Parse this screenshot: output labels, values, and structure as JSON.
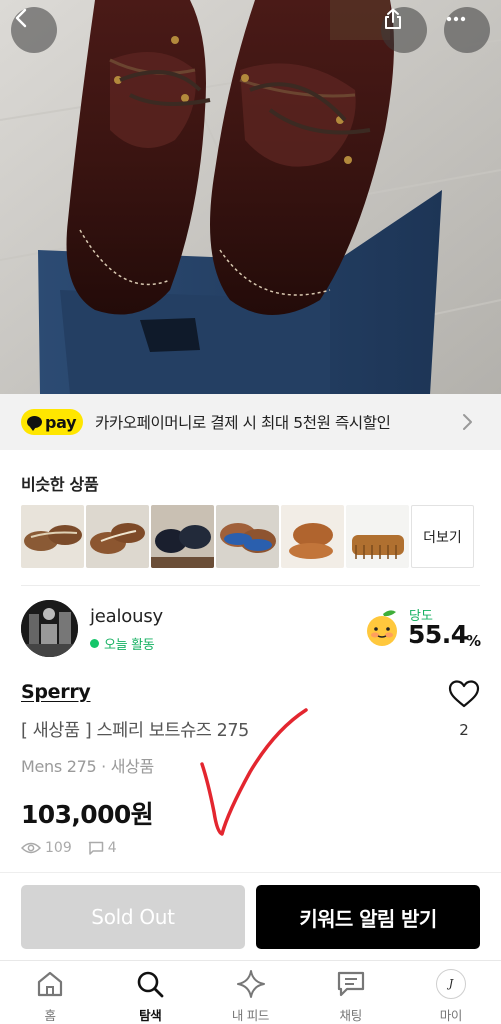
{
  "colors": {
    "pay_yellow": "#ffe600",
    "online_green": "#16b162",
    "sold_out_gray": "#d4d4d4",
    "primary_black": "#000000",
    "annotation_red": "#e3262f"
  },
  "header": {
    "back_icon": "chevron-left-icon",
    "share_icon": "share-icon",
    "more_icon": "more-horizontal-icon"
  },
  "pay_banner": {
    "badge": "pay",
    "text": "카카오페이머니로 결제 시 최대 5천원 즉시할인"
  },
  "similar": {
    "title": "비슷한 상품",
    "more_label": "더보기"
  },
  "seller": {
    "name": "jealousy",
    "status": "오늘 활동",
    "sweetness_label": "당도",
    "sweetness_value": "55.4",
    "sweetness_unit": "%"
  },
  "product": {
    "brand": "Sperry",
    "title": "[ 새상품 ] 스페리 보트슈즈 275",
    "meta": "Mens 275 · 새상품",
    "price": "103,000원",
    "like_count": "2",
    "views": "109",
    "chats": "4"
  },
  "actions": {
    "sold_out": "Sold Out",
    "keyword_alert": "키워드 알림 받기"
  },
  "tabs": [
    {
      "label": "홈",
      "icon": "home-icon"
    },
    {
      "label": "탐색",
      "icon": "search-icon",
      "active": true
    },
    {
      "label": "내 피드",
      "icon": "sparkle-icon"
    },
    {
      "label": "채팅",
      "icon": "chat-icon"
    },
    {
      "label": "마이",
      "icon": "profile-icon"
    }
  ]
}
